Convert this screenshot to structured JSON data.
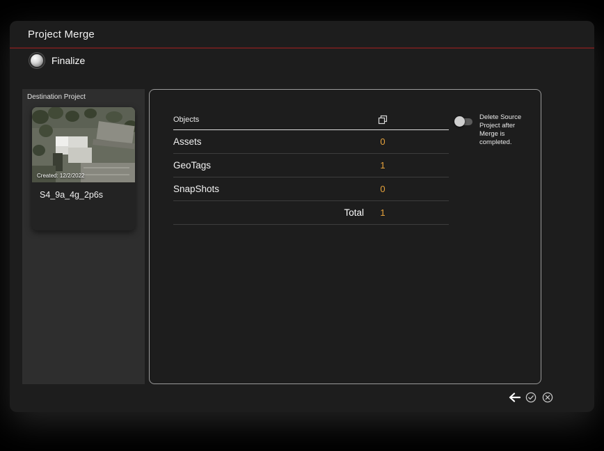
{
  "window": {
    "title": "Project Merge",
    "step_label": "Finalize"
  },
  "destination": {
    "panel_label": "Destination Project",
    "created_label": "Created: 12/2/2022",
    "project_name": "S4_9a_4g_2p6s"
  },
  "table": {
    "header_label": "Objects",
    "header_icon": "stacked-layers-icon",
    "rows": [
      {
        "label": "Assets",
        "value": "0"
      },
      {
        "label": "GeoTags",
        "value": "1"
      },
      {
        "label": "SnapShots",
        "value": "0"
      }
    ],
    "total_label": "Total",
    "total_value": "1"
  },
  "delete_toggle": {
    "label": "Delete Source Project after Merge is completed.",
    "state": "off"
  },
  "footer": {
    "icons": [
      "back-arrow-icon",
      "check-circle-icon",
      "close-circle-icon"
    ]
  },
  "colors": {
    "value_accent": "#e8a33c",
    "title_divider": "#661f1f",
    "window_bg": "#1d1d1d",
    "panel_bg": "#2e2e2e"
  }
}
